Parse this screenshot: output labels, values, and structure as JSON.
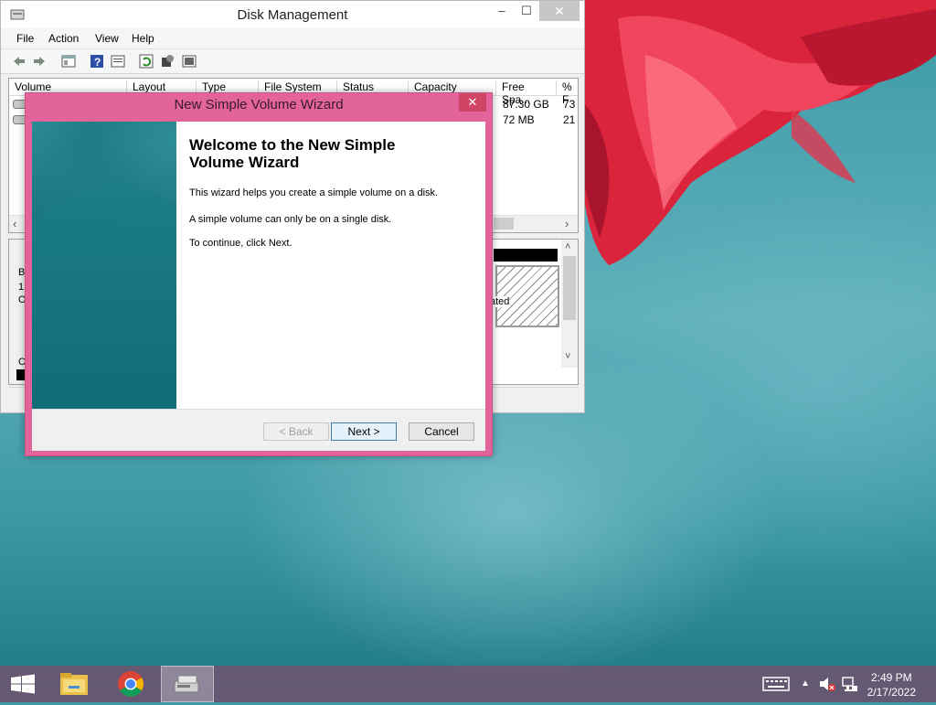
{
  "disk_management": {
    "title": "Disk Management",
    "controls": {
      "minimize": "‒",
      "maximize": "☐",
      "close": "✕"
    },
    "menu": [
      "File",
      "Action",
      "View",
      "Help"
    ],
    "columns": [
      "Volume",
      "Layout",
      "Type",
      "File System",
      "Status",
      "Capacity",
      "Free Spa...",
      "% F"
    ],
    "rows": [
      {
        "free": "87.30 GB",
        "pct": "73"
      },
      {
        "free": "72 MB",
        "pct": "21"
      }
    ],
    "side_letters": [
      "B",
      "1.",
      "O",
      "C"
    ],
    "unallocated_fragment": "ated"
  },
  "wizard": {
    "title": "New Simple Volume Wizard",
    "close": "✕",
    "heading_line1": "Welcome to the New Simple",
    "heading_line2": "Volume Wizard",
    "paragraphs": [
      "This wizard helps you create a simple volume on a disk.",
      "A simple volume can only be on a single disk.",
      "To continue, click Next."
    ],
    "buttons": {
      "back": "< Back",
      "next": "Next >",
      "cancel": "Cancel"
    }
  },
  "taskbar": {
    "time": "2:49 PM",
    "date": "2/17/2022",
    "apps": [
      "file-explorer-icon",
      "chrome-icon",
      "disk-management-icon"
    ]
  }
}
